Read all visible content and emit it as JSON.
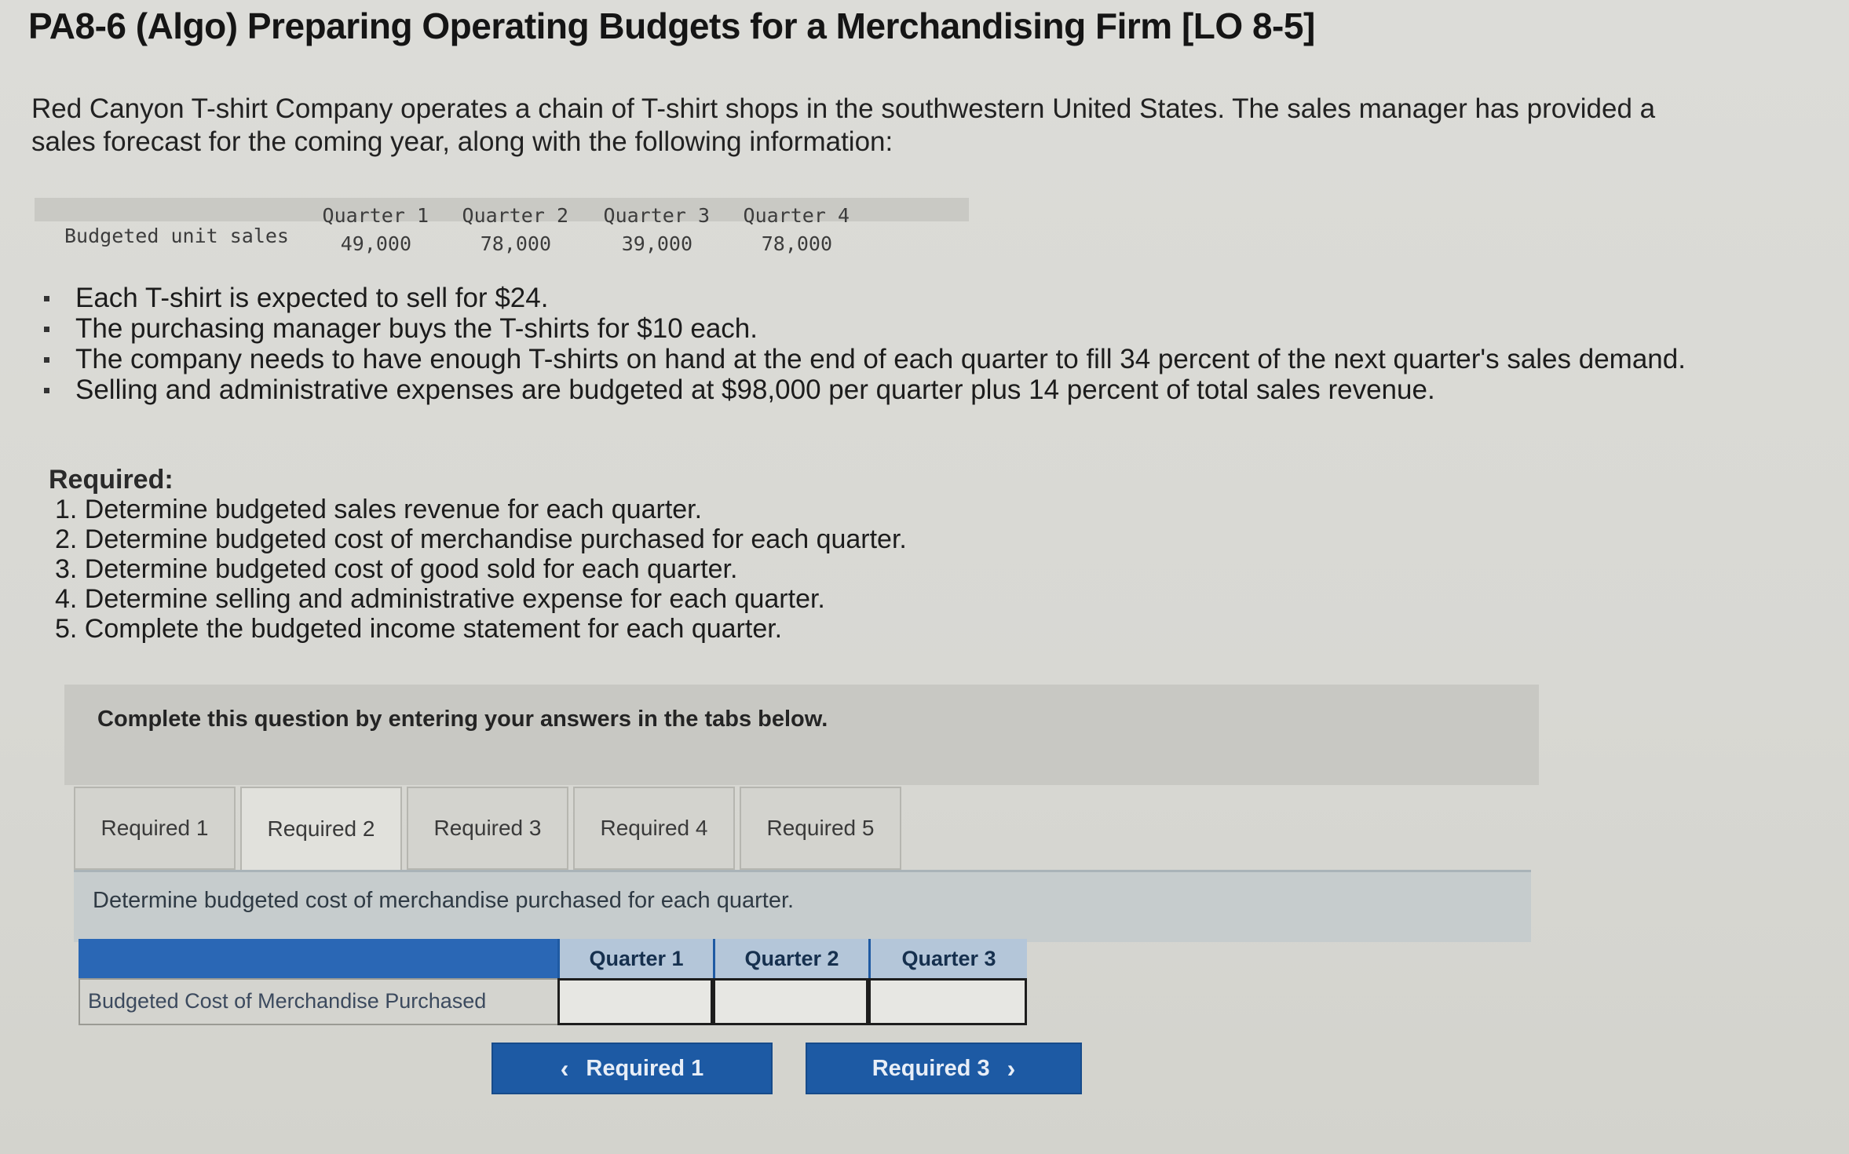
{
  "title": "PA8-6 (Algo) Preparing Operating Budgets for a Merchandising Firm [LO 8-5]",
  "intro": "Red Canyon T-shirt Company operates a chain of T-shirt shops in the southwestern United States. The sales manager has provided a sales forecast for the coming year, along with the following information:",
  "forecast": {
    "row_label": "Budgeted unit sales",
    "quarters": [
      "Quarter 1",
      "Quarter 2",
      "Quarter 3",
      "Quarter 4"
    ],
    "values": [
      "49,000",
      "78,000",
      "39,000",
      "78,000"
    ]
  },
  "bullets": [
    "Each T-shirt is expected to sell for $24.",
    "The purchasing manager buys the T-shirts for $10 each.",
    "The company needs to have enough T-shirts on hand at the end of each quarter to fill 34 percent of the next quarter's sales demand.",
    "Selling and administrative expenses are budgeted at $98,000 per quarter plus 14 percent of total sales revenue."
  ],
  "required": {
    "heading": "Required:",
    "items": [
      "1. Determine budgeted sales revenue for each quarter.",
      "2. Determine budgeted cost of merchandise purchased for each quarter.",
      "3. Determine budgeted cost of good sold for each quarter.",
      "4. Determine selling and administrative expense for each quarter.",
      "5. Complete the budgeted income statement for each quarter."
    ]
  },
  "instructions": "Complete this question by entering your answers in the tabs below.",
  "tabs": [
    "Required 1",
    "Required 2",
    "Required 3",
    "Required 4",
    "Required 5"
  ],
  "active_tab": "Required 2",
  "tab_description": "Determine budgeted cost of merchandise purchased for each quarter.",
  "answer_table": {
    "columns": [
      "Quarter 1",
      "Quarter 2",
      "Quarter 3"
    ],
    "row_label": "Budgeted Cost of Merchandise Purchased",
    "values": [
      "",
      "",
      ""
    ]
  },
  "nav": {
    "prev_label": "Required 1",
    "next_label": "Required 3",
    "prev_icon": "chevron-left-icon",
    "next_icon": "chevron-right-icon"
  },
  "colors": {
    "nav_button": "#1d5aa4",
    "table_header_bar": "#2a67b5"
  }
}
